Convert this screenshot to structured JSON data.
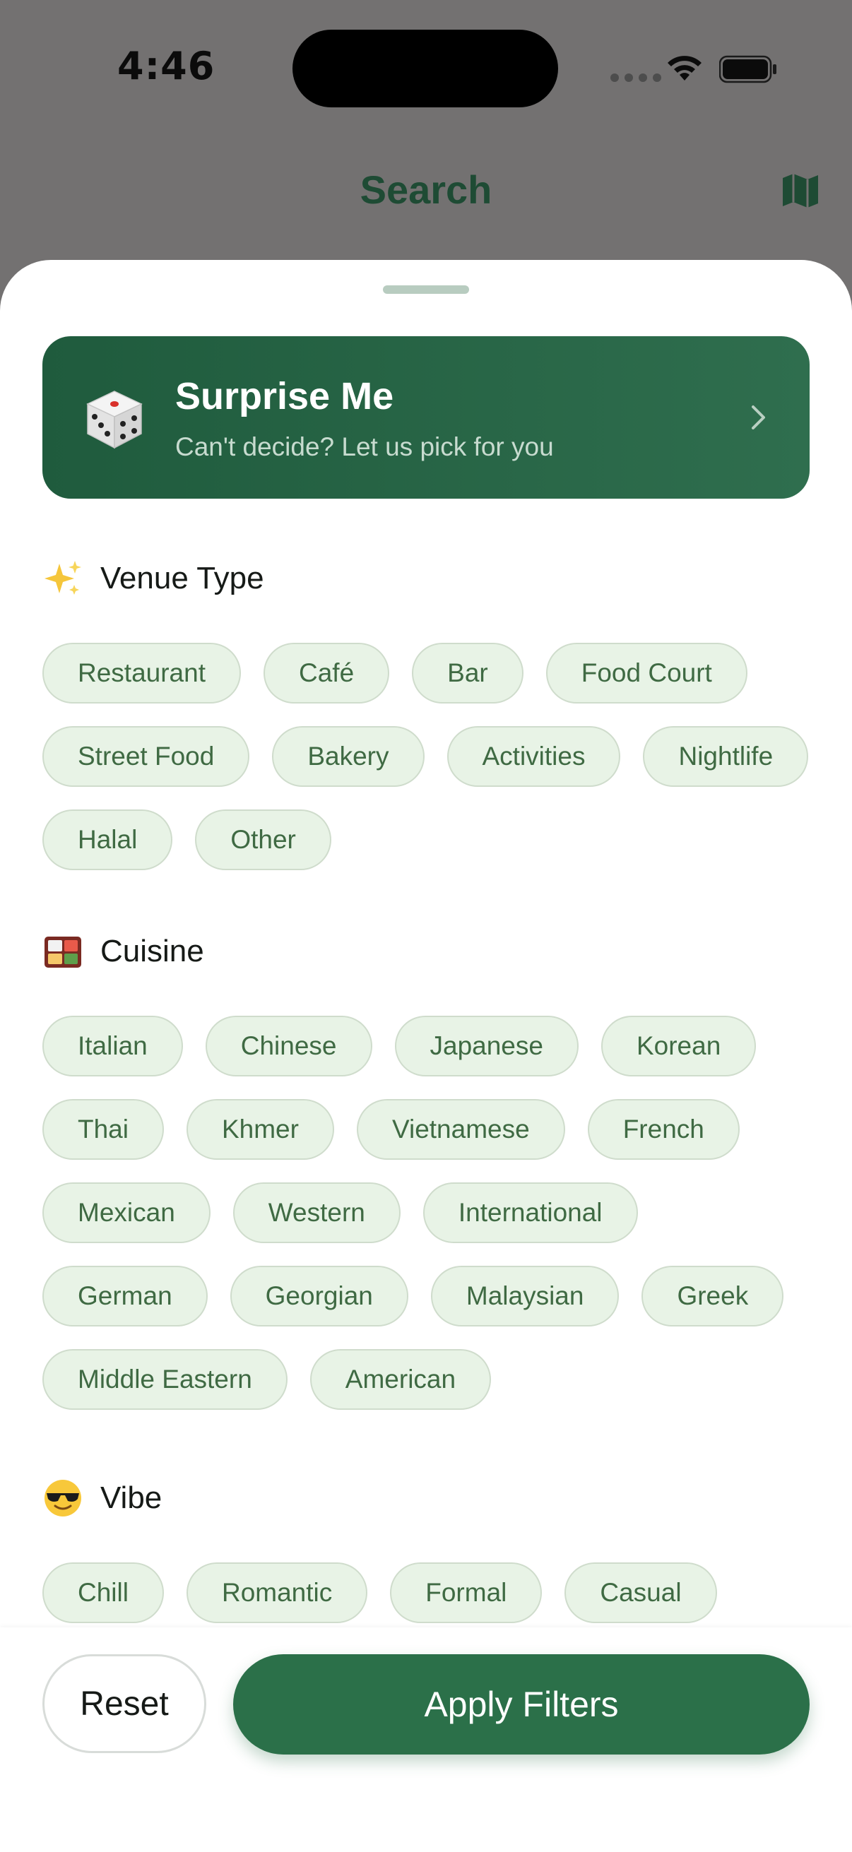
{
  "status_bar": {
    "time": "4:46"
  },
  "header": {
    "title": "Search",
    "map_icon": "map-icon"
  },
  "surprise": {
    "title": "Surprise Me",
    "subtitle": "Can't decide? Let us pick for you",
    "icon": "dice-icon"
  },
  "sections": {
    "venue_type": {
      "emoji": "sparkles-icon",
      "title": "Venue Type",
      "chips": [
        "Restaurant",
        "Café",
        "Bar",
        "Food Court",
        "Street Food",
        "Bakery",
        "Activities",
        "Nightlife",
        "Halal",
        "Other"
      ]
    },
    "cuisine": {
      "emoji": "bento-box-icon",
      "title": "Cuisine",
      "chips": [
        "Italian",
        "Chinese",
        "Japanese",
        "Korean",
        "Thai",
        "Khmer",
        "Vietnamese",
        "French",
        "Mexican",
        "Western",
        "International",
        "German",
        "Georgian",
        "Malaysian",
        "Greek",
        "Middle Eastern",
        "American"
      ]
    },
    "vibe": {
      "emoji": "sunglasses-face-icon",
      "title": "Vibe",
      "chips": [
        "Chill",
        "Romantic",
        "Formal",
        "Casual"
      ]
    }
  },
  "actions": {
    "reset_label": "Reset",
    "apply_label": "Apply Filters"
  },
  "colors": {
    "brand_green": "#2b7049",
    "chip_bg": "#e8f3e6",
    "chip_text": "#3f6a43"
  }
}
